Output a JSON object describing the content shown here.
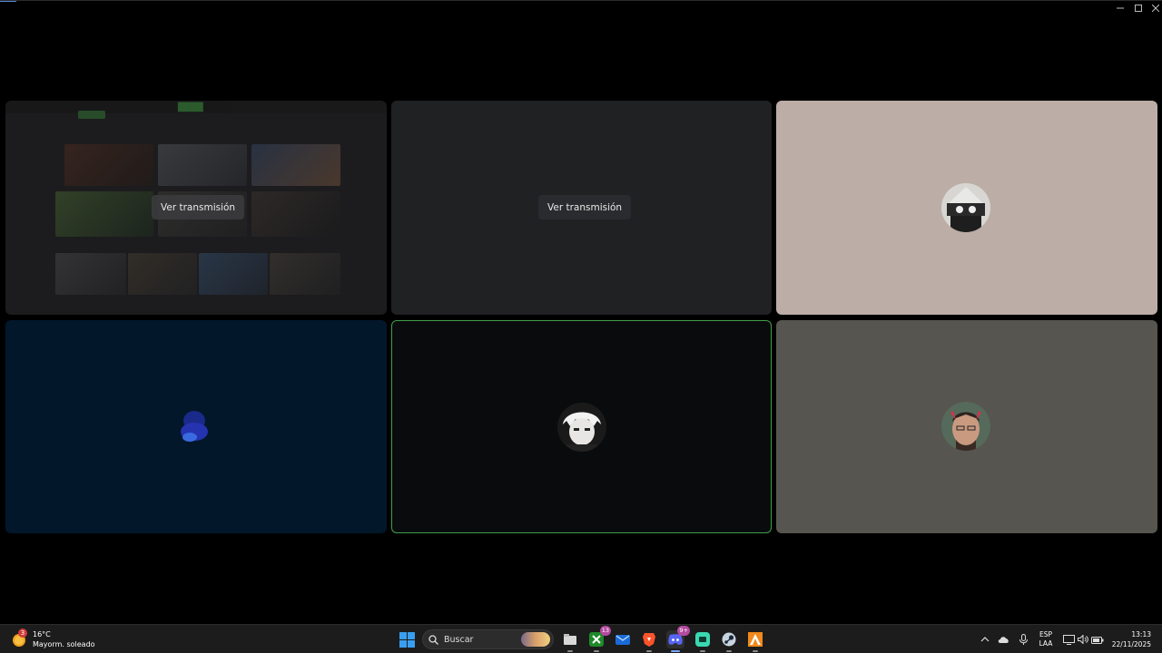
{
  "window": {
    "controls": {
      "minimize_icon": "minimize-icon",
      "maximize_icon": "maximize-icon",
      "close_icon": "close-icon"
    }
  },
  "tiles": [
    {
      "type": "screen-share",
      "button_label": "Ver transmisión",
      "background": "#1c1c1e"
    },
    {
      "type": "screen-share",
      "button_label": "Ver transmisión",
      "background": "#202123"
    },
    {
      "type": "participant",
      "avatar_icon": "avatar-image",
      "background": "#bcaea6"
    },
    {
      "type": "participant",
      "avatar_icon": "avatar-image",
      "background": "#02172a"
    },
    {
      "type": "participant",
      "avatar_icon": "avatar-image",
      "background": "#0a0b0c",
      "speaking": true,
      "border_color": "#3fa04b"
    },
    {
      "type": "participant",
      "avatar_icon": "avatar-image",
      "background": "#575550"
    }
  ],
  "taskbar": {
    "weather": {
      "temperature": "16°C",
      "condition": "Mayorm. soleado",
      "badge": "3"
    },
    "search": {
      "placeholder": "Buscar"
    },
    "apps": [
      {
        "name": "file-explorer",
        "icon": "folder-icon"
      },
      {
        "name": "xbox",
        "icon": "xbox-icon",
        "badge": "13"
      },
      {
        "name": "mail",
        "icon": "mail-icon"
      },
      {
        "name": "brave",
        "icon": "brave-icon"
      },
      {
        "name": "discord",
        "icon": "discord-icon",
        "badge": "9+",
        "active": true
      },
      {
        "name": "chat-app",
        "icon": "chat-icon"
      },
      {
        "name": "steam",
        "icon": "steam-icon"
      },
      {
        "name": "launcher",
        "icon": "launcher-icon"
      }
    ],
    "tray": {
      "language": "ESP",
      "layout": "LAA",
      "time": "13:13",
      "date": "22/11/2025"
    }
  }
}
